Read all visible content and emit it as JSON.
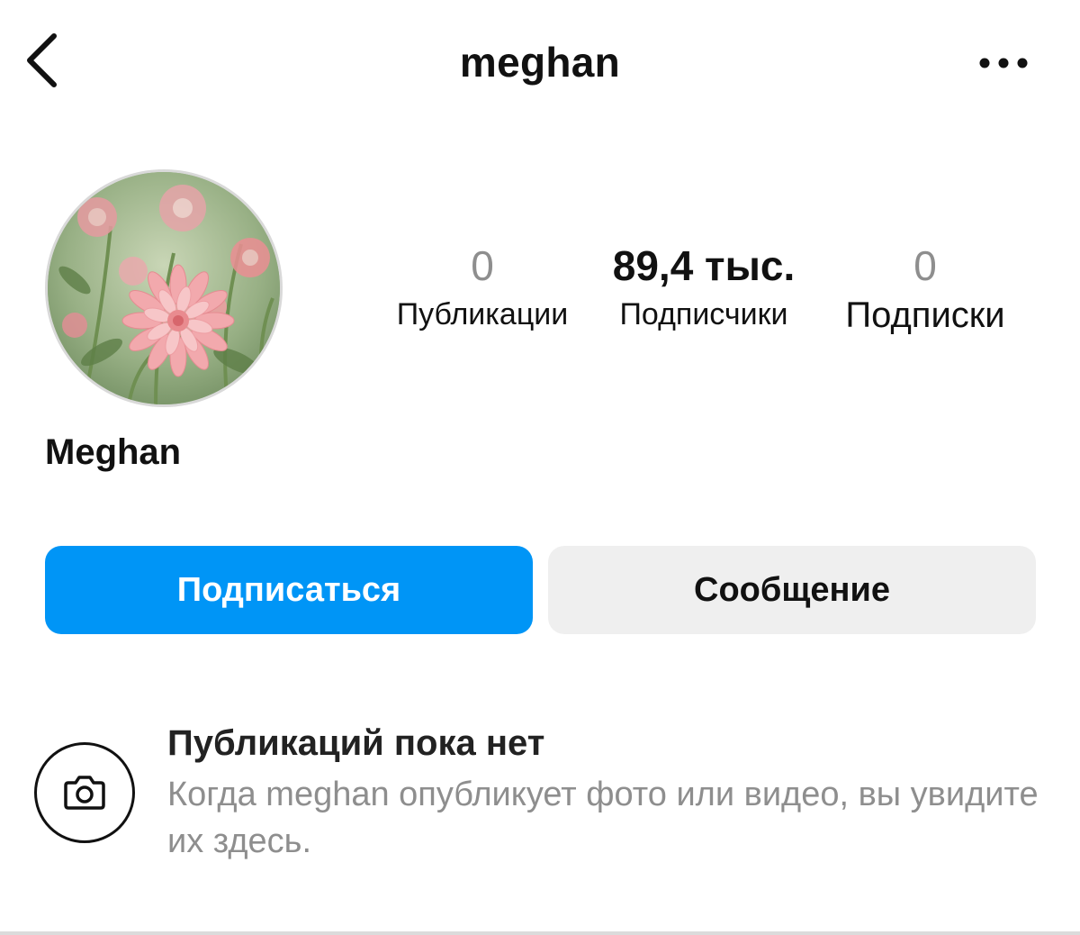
{
  "header": {
    "username": "meghan",
    "back_icon": "chevron-left-icon",
    "more_icon": "more-horizontal-icon"
  },
  "profile": {
    "display_name": "Meghan",
    "avatar_description": "pink-dahlia-flowers-avatar"
  },
  "stats": [
    {
      "value": "0",
      "label": "Публикации"
    },
    {
      "value": "89,4 тыс.",
      "label": "Подписчики"
    },
    {
      "value": "0",
      "label": "Подписки"
    }
  ],
  "actions": {
    "follow_label": "Подписаться",
    "message_label": "Сообщение"
  },
  "empty_state": {
    "icon": "camera-icon",
    "title": "Публикаций пока нет",
    "description": "Когда meghan опубликует фото или видео, вы увидите их здесь."
  },
  "colors": {
    "primary": "#0095f6",
    "secondary_button": "#efefef",
    "muted_text": "#8e8e8e",
    "text": "#111111"
  }
}
